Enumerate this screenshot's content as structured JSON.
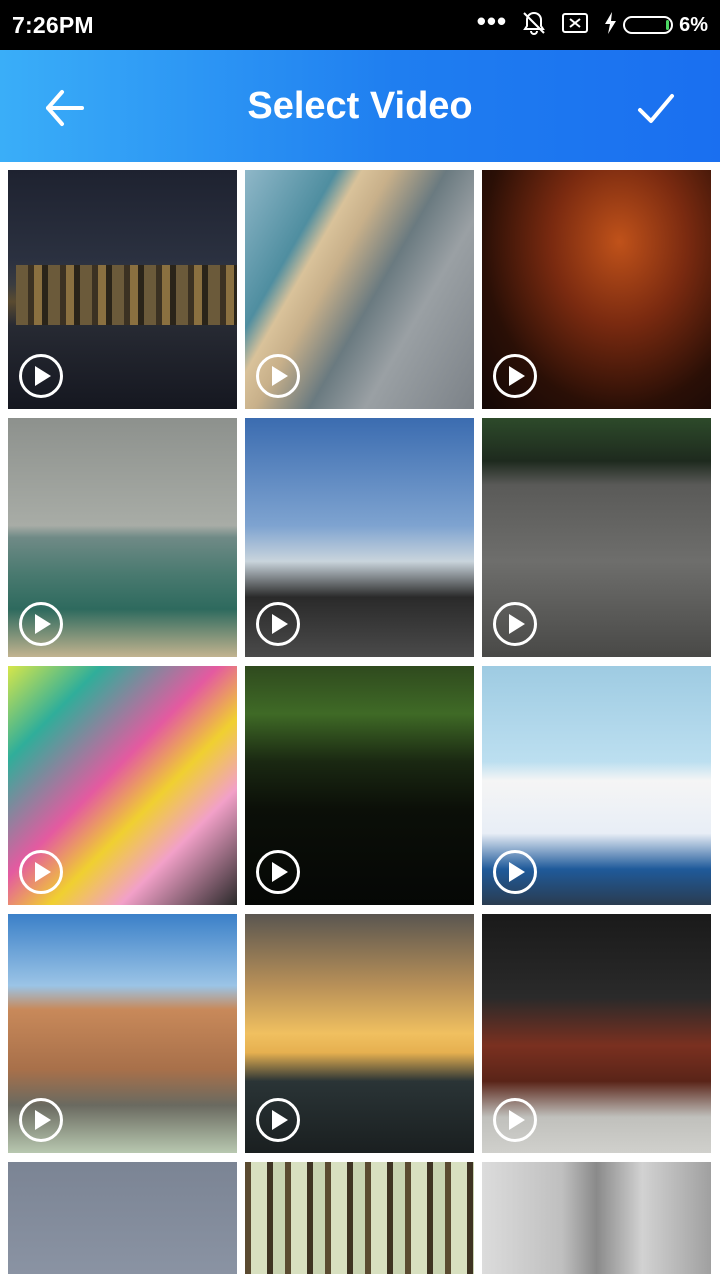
{
  "status_bar": {
    "time": "7:26PM",
    "dots": "•••",
    "battery_percent": "6%",
    "battery_level": 0.06,
    "icons": [
      "dots-icon",
      "bell-muted-icon",
      "sim-x-icon",
      "charging-bolt-icon",
      "battery-icon"
    ]
  },
  "app_bar": {
    "title": "Select Video",
    "back_icon": "arrow-left-icon",
    "confirm_icon": "check-icon",
    "gradient": [
      "#3aaef8",
      "#1a6ff0"
    ]
  },
  "videos": [
    {
      "thumb": "city-night-waterfront",
      "play_icon": "play-icon"
    },
    {
      "thumb": "aerial-beach-city",
      "play_icon": "play-icon"
    },
    {
      "thumb": "night-tree-lights",
      "play_icon": "play-icon"
    },
    {
      "thumb": "coast-pier-overcast",
      "play_icon": "play-icon"
    },
    {
      "thumb": "city-skyline-crowd",
      "play_icon": "play-icon"
    },
    {
      "thumb": "dusty-car-window",
      "play_icon": "play-icon"
    },
    {
      "thumb": "carnival-ride",
      "play_icon": "play-icon"
    },
    {
      "thumb": "forest-river",
      "play_icon": "play-icon"
    },
    {
      "thumb": "ferry-boat",
      "play_icon": "play-icon"
    },
    {
      "thumb": "fountain-plaza",
      "play_icon": "play-icon"
    },
    {
      "thumb": "sunset-sea",
      "play_icon": "play-icon"
    },
    {
      "thumb": "person-at-chest",
      "play_icon": "play-icon"
    },
    {
      "thumb": "grey-sky",
      "play_icon": null
    },
    {
      "thumb": "tall-forest",
      "play_icon": null
    },
    {
      "thumb": "city-buildings",
      "play_icon": null
    }
  ]
}
